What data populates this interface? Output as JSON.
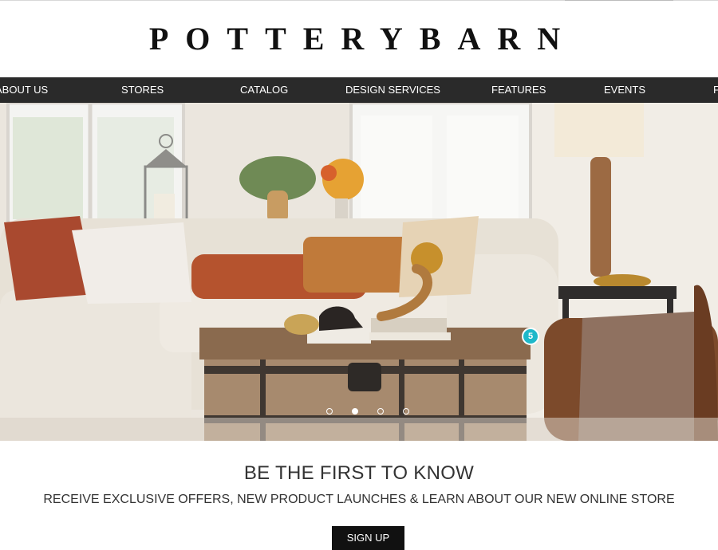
{
  "brand": {
    "logo_text": "POTTERYBARN"
  },
  "nav": {
    "items": [
      {
        "label": "ABOUT US"
      },
      {
        "label": "STORES"
      },
      {
        "label": "CATALOG"
      },
      {
        "label": "DESIGN SERVICES"
      },
      {
        "label": "FEATURES"
      },
      {
        "label": "EVENTS"
      },
      {
        "label": "F"
      }
    ]
  },
  "hero": {
    "badge_count": "5",
    "carousel": {
      "slide_count": 4,
      "active_index": 1
    }
  },
  "signup": {
    "title": "BE THE FIRST TO KNOW",
    "subtitle": "RECEIVE EXCLUSIVE OFFERS, NEW PRODUCT LAUNCHES & LEARN ABOUT OUR NEW ONLINE STORE",
    "button_label": "SIGN UP"
  },
  "colors": {
    "nav_bg": "#2a2a2a",
    "badge": "#1fb8c9",
    "button_bg": "#111111"
  }
}
